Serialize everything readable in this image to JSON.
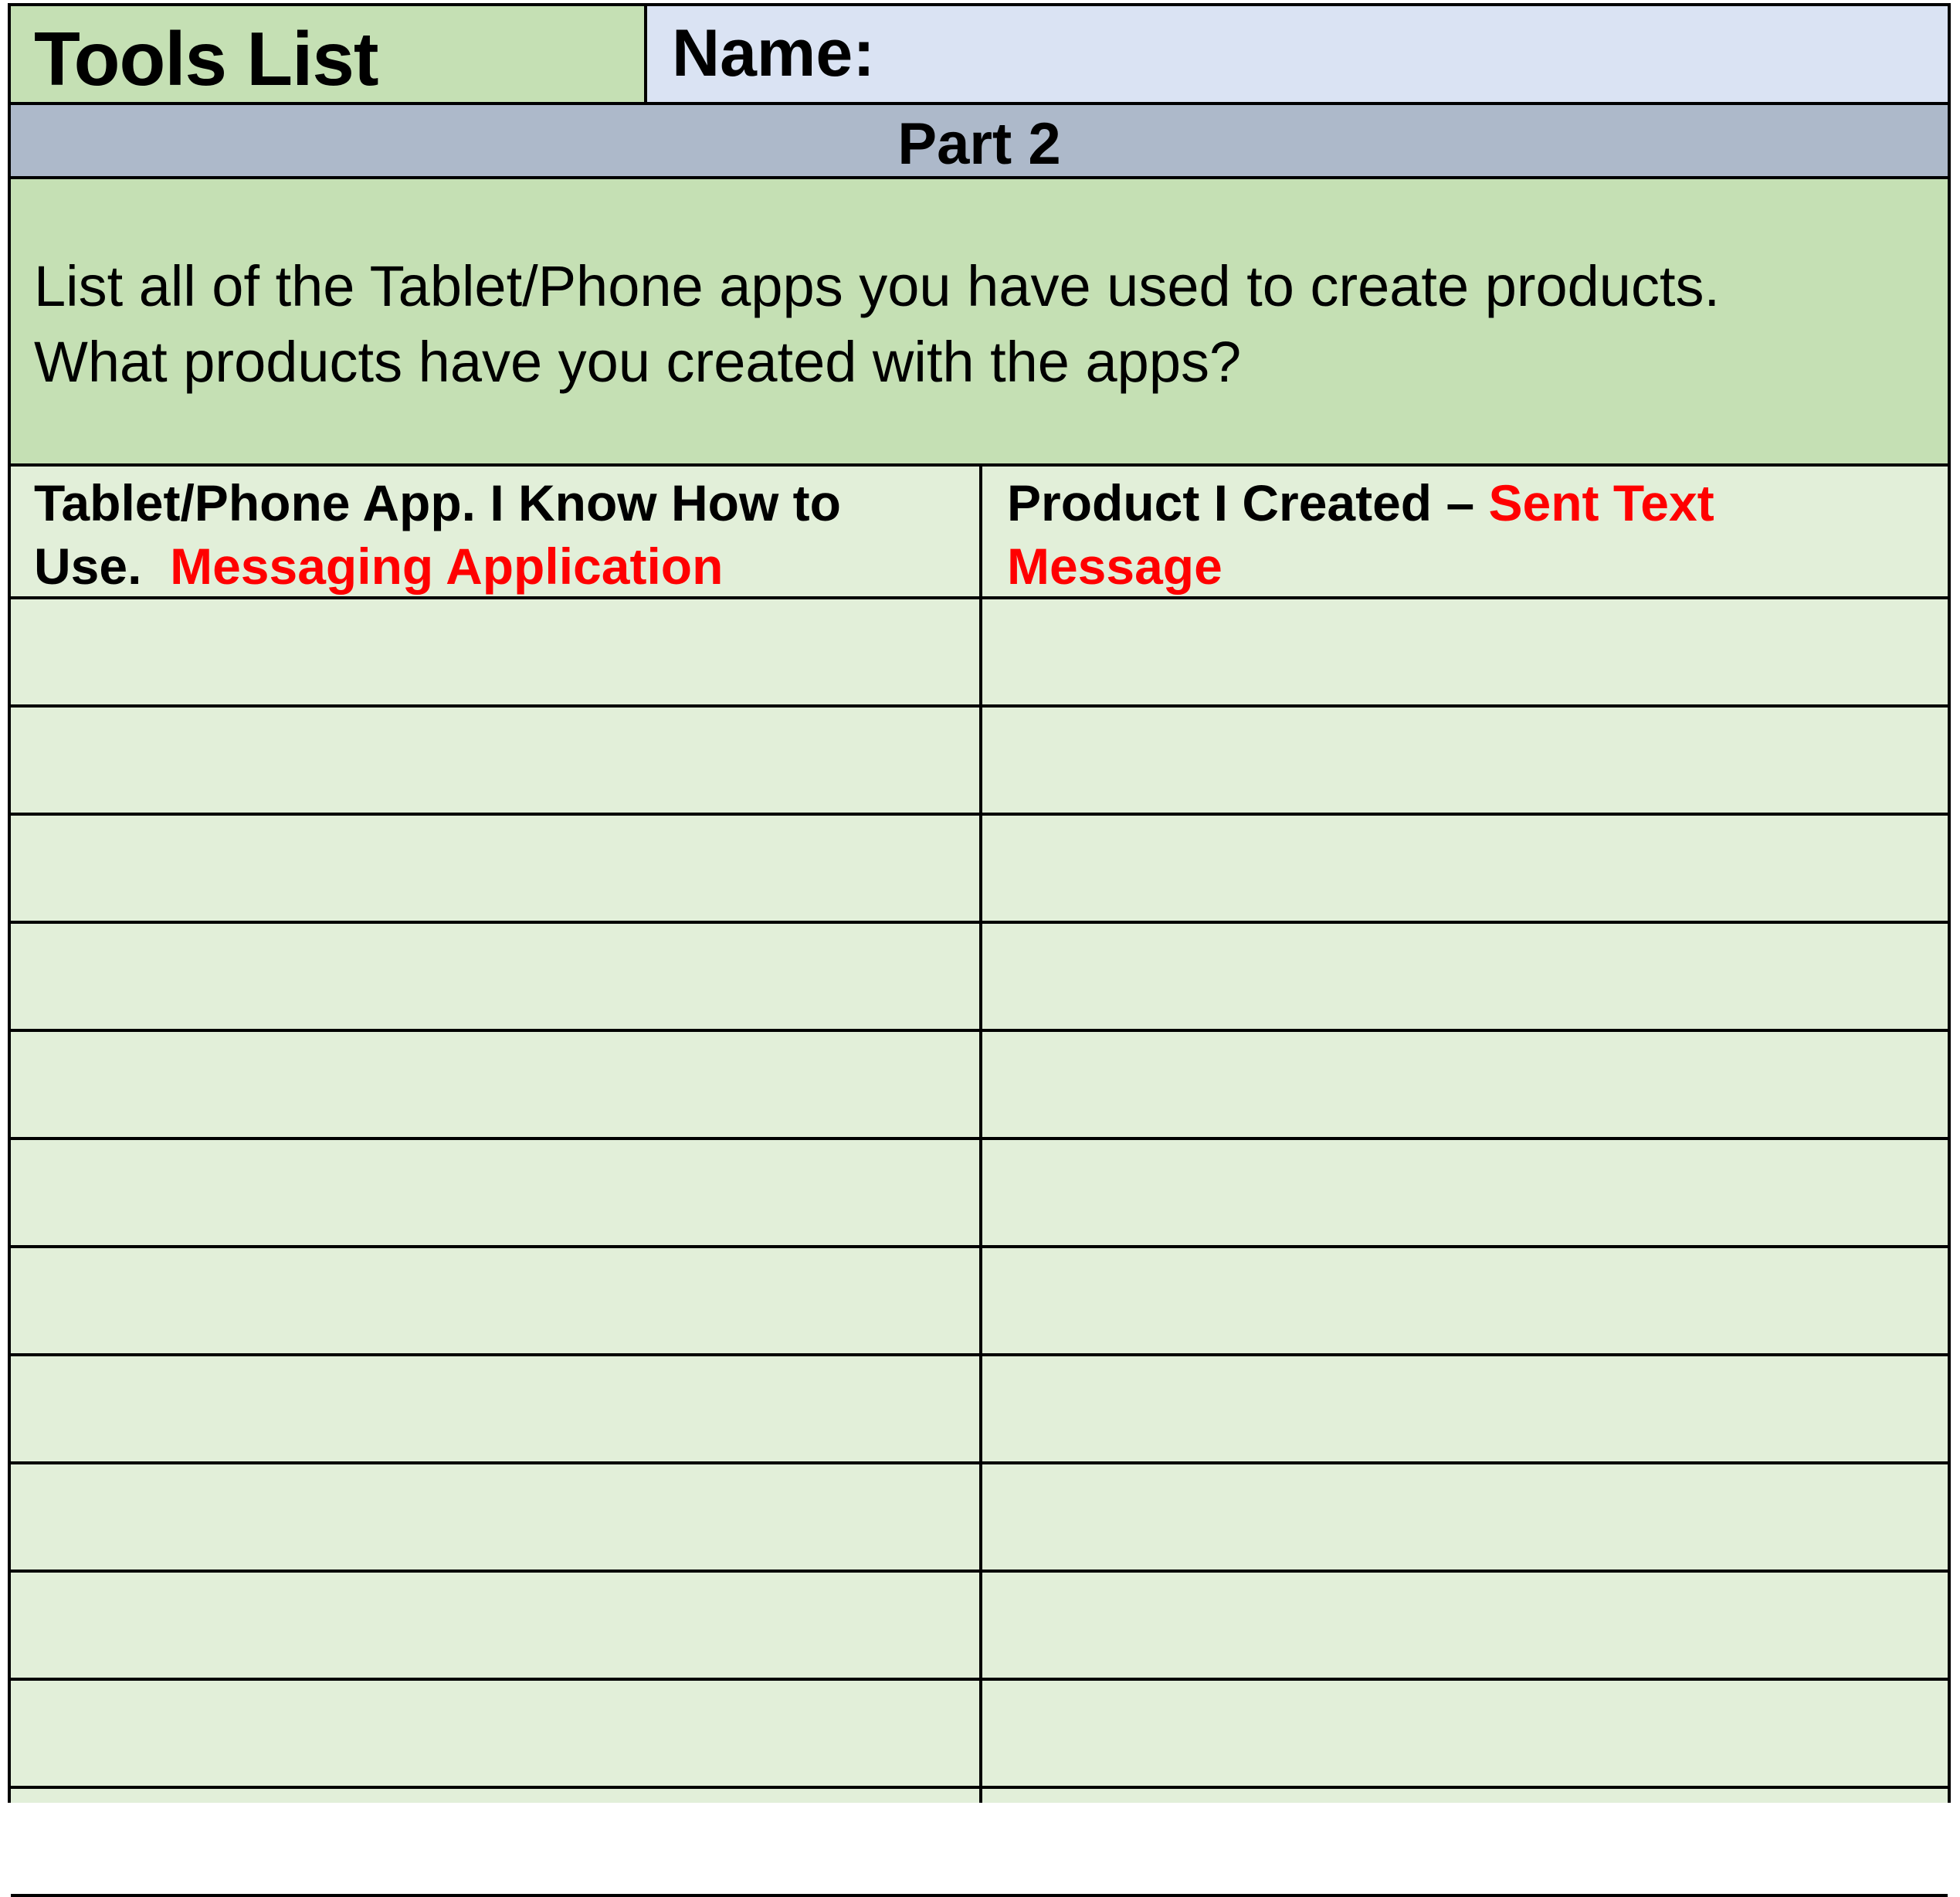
{
  "header": {
    "title": "Tools List",
    "name_label": "Name:"
  },
  "part": {
    "label": "Part 2"
  },
  "instructions": {
    "line1": "List all of the Tablet/Phone apps you have used to create products.",
    "line2": "What products have you created with the apps?"
  },
  "table": {
    "columns": [
      {
        "label_line1": "Tablet/Phone App. I Know How to",
        "label_line2": "Use.",
        "example": "Messaging Application"
      },
      {
        "label_prefix": "Product I Created –",
        "example_line1": "Sent Text",
        "example_line2": "Message"
      }
    ],
    "rows": [
      [
        "",
        ""
      ],
      [
        "",
        ""
      ],
      [
        "",
        ""
      ],
      [
        "",
        ""
      ],
      [
        "",
        ""
      ],
      [
        "",
        ""
      ],
      [
        "",
        ""
      ],
      [
        "",
        ""
      ],
      [
        "",
        ""
      ],
      [
        "",
        ""
      ],
      [
        "",
        ""
      ],
      [
        "",
        ""
      ]
    ]
  },
  "colors": {
    "title_bg": "#c5e0b4",
    "name_bg": "#dae3f3",
    "part_bg": "#adb9ca",
    "grid_bg": "#e2efd9",
    "example_text": "#ff0000"
  }
}
